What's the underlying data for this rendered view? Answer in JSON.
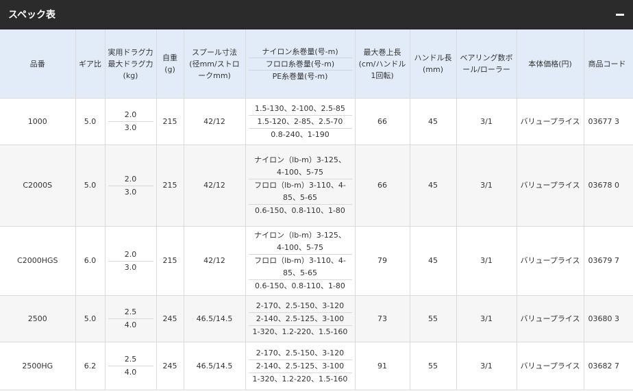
{
  "panel": {
    "title": "スペック表"
  },
  "headers": {
    "hinban": "品番",
    "gear": "ギア比",
    "drag_practical": "実用ドラグ力",
    "drag_max": "最大ドラグ力",
    "drag_unit": "(kg)",
    "weight": "自重(g)",
    "spool": "スプール寸法(径mm/ストロークmm)",
    "line_nylon": "ナイロン糸巻量(号-m)",
    "line_fluoro": "フロロ糸巻量(号-m)",
    "line_pe": "PE糸巻量(号-m)",
    "retrieve": "最大巻上長(cm/ハンドル1回転)",
    "handle": "ハンドル長(mm)",
    "bearing": "ベアリング数ボール/ローラー",
    "price": "本体価格(円)",
    "code": "商品コード"
  },
  "rows": [
    {
      "hinban": "1000",
      "gear": "5.0",
      "drag_practical": "2.0",
      "drag_max": "3.0",
      "weight": "215",
      "spool": "42/12",
      "lines": [
        "1.5-130、2-100、2.5-85",
        "1.5-120、2-85、2.5-70",
        "0.8-240、1-190"
      ],
      "retrieve": "66",
      "handle": "45",
      "bearing": "3/1",
      "price": "バリュープライス",
      "code": "03677 3"
    },
    {
      "hinban": "C2000S",
      "gear": "5.0",
      "drag_practical": "2.0",
      "drag_max": "3.0",
      "weight": "215",
      "spool": "42/12",
      "lines": [
        "ナイロン（lb-m）3-125、4-100、5-75",
        "フロロ（lb-m）3-110、4-85、5-65",
        "0.6-150、0.8-110、1-80"
      ],
      "retrieve": "66",
      "handle": "45",
      "bearing": "3/1",
      "price": "バリュープライス",
      "code": "03678 0"
    },
    {
      "hinban": "C2000HGS",
      "gear": "6.0",
      "drag_practical": "2.0",
      "drag_max": "3.0",
      "weight": "215",
      "spool": "42/12",
      "lines": [
        "ナイロン（lb-m）3-125、4-100、5-75",
        "フロロ（lb-m）3-110、4-85、5-65",
        "0.6-150、0.8-110、1-80"
      ],
      "retrieve": "79",
      "handle": "45",
      "bearing": "3/1",
      "price": "バリュープライス",
      "code": "03679 7"
    },
    {
      "hinban": "2500",
      "gear": "5.0",
      "drag_practical": "2.5",
      "drag_max": "4.0",
      "weight": "245",
      "spool": "46.5/14.5",
      "lines": [
        "2-170、2.5-150、3-120",
        "2-140、2.5-125、3-100",
        "1-320、1.2-220、1.5-160"
      ],
      "retrieve": "73",
      "handle": "55",
      "bearing": "3/1",
      "price": "バリュープライス",
      "code": "03680 3"
    },
    {
      "hinban": "2500HG",
      "gear": "6.2",
      "drag_practical": "2.5",
      "drag_max": "4.0",
      "weight": "245",
      "spool": "46.5/14.5",
      "lines": [
        "2-170、2.5-150、3-120",
        "2-140、2.5-125、3-100",
        "1-320、1.2-220、1.5-160"
      ],
      "retrieve": "91",
      "handle": "55",
      "bearing": "3/1",
      "price": "バリュープライス",
      "code": "03682 7"
    }
  ]
}
